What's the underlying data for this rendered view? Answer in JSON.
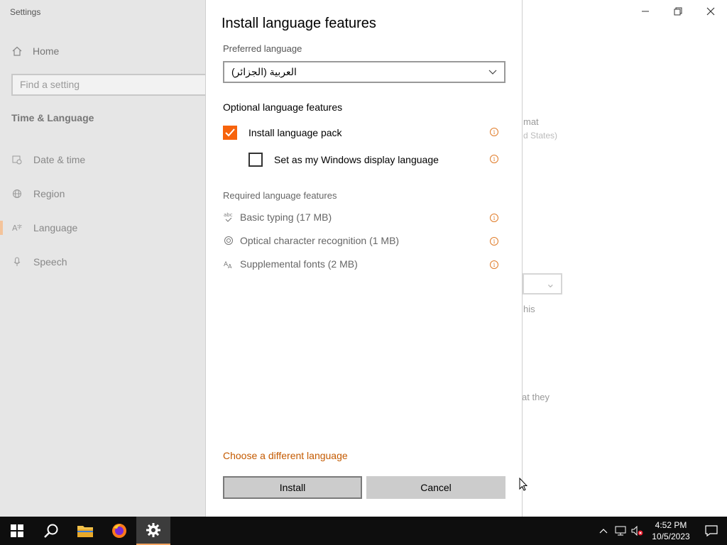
{
  "window": {
    "app_title": "Settings",
    "controls": {
      "minimize": "—",
      "restore": "❐",
      "close": "✕"
    }
  },
  "sidebar": {
    "home_label": "Home",
    "search_placeholder": "Find a setting",
    "section_title": "Time & Language",
    "items": [
      {
        "label": "Date & time",
        "icon": "calendar-clock-icon"
      },
      {
        "label": "Region",
        "icon": "globe-icon"
      },
      {
        "label": "Language",
        "icon": "language-icon",
        "active": true
      },
      {
        "label": "Speech",
        "icon": "microphone-icon"
      }
    ]
  },
  "background_fragments": {
    "format": "mat",
    "region_value": "d States)",
    "this": "his",
    "at_they": "at they"
  },
  "dialog": {
    "title": "Install language features",
    "preferred_label": "Preferred language",
    "preferred_value": "العربية (الجزائر)",
    "optional_label": "Optional language features",
    "optional": [
      {
        "label": "Install language pack",
        "checked": true
      },
      {
        "label": "Set as my Windows display language",
        "checked": false
      }
    ],
    "required_label": "Required language features",
    "required": [
      {
        "label": "Basic typing (17 MB)",
        "icon": "typing-icon"
      },
      {
        "label": "Optical character recognition (1 MB)",
        "icon": "ocr-icon"
      },
      {
        "label": "Supplemental fonts (2 MB)",
        "icon": "fonts-icon"
      }
    ],
    "choose_link": "Choose a different language",
    "install_label": "Install",
    "cancel_label": "Cancel"
  },
  "taskbar": {
    "time": "4:52 PM",
    "date": "10/5/2023"
  },
  "colors": {
    "accent": "#f7630c",
    "link": "#c45a00",
    "taskbar": "#0e0e0e"
  }
}
